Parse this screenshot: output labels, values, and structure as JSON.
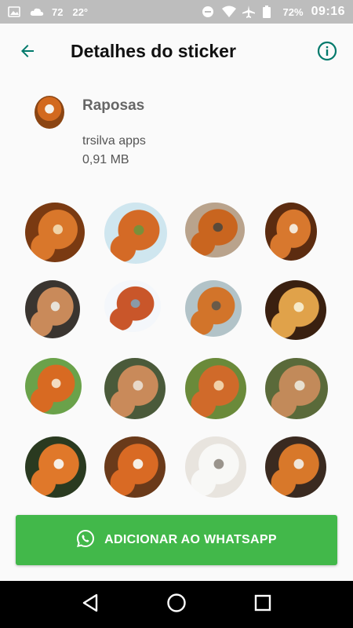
{
  "status_bar": {
    "left_icons": [
      "image-icon",
      "cloud-icon"
    ],
    "battery_small": "72",
    "temperature": "22°",
    "right_icons": [
      "do-not-disturb-icon",
      "wifi-icon",
      "airplane-icon",
      "battery-icon"
    ],
    "battery_percent": "72%",
    "time": "09:16"
  },
  "app_bar": {
    "back_icon": "arrow-left-icon",
    "title": "Detalhes do sticker",
    "info_icon": "info-icon",
    "accent": "#00796b"
  },
  "pack": {
    "name": "Raposas",
    "publisher": "trsilva apps",
    "size": "0,91 MB"
  },
  "stickers": [
    {
      "name": "fox-sticker-1",
      "colors": [
        "#7a3a12",
        "#d9772b",
        "#f0d3a8"
      ]
    },
    {
      "name": "fox-sticker-2",
      "colors": [
        "#cfe6ef",
        "#d46a26",
        "#7a8f3a"
      ]
    },
    {
      "name": "fox-sticker-3",
      "colors": [
        "#b9a38c",
        "#c9651f",
        "#5a4a3a"
      ]
    },
    {
      "name": "fox-sticker-4",
      "colors": [
        "#5c2c10",
        "#d8782e",
        "#f4e7d7"
      ]
    },
    {
      "name": "fox-sticker-5",
      "colors": [
        "#3a3530",
        "#c98a5a",
        "#e8e2d8"
      ]
    },
    {
      "name": "fox-sticker-6",
      "colors": [
        "#f4f7fb",
        "#c9562a",
        "#8a9aa8"
      ]
    },
    {
      "name": "fox-sticker-7",
      "colors": [
        "#b2c3c8",
        "#d2742a",
        "#6a5a48"
      ]
    },
    {
      "name": "fox-sticker-8",
      "colors": [
        "#3a2010",
        "#e0a24a",
        "#f6e9c8"
      ]
    },
    {
      "name": "fox-sticker-9",
      "colors": [
        "#6aa24a",
        "#d86a22",
        "#f2dcc2"
      ]
    },
    {
      "name": "fox-sticker-10",
      "colors": [
        "#4a5a3a",
        "#c98a5a",
        "#e8d8c8"
      ]
    },
    {
      "name": "fox-sticker-11",
      "colors": [
        "#6a8a3a",
        "#d06a2a",
        "#f0d0a8"
      ]
    },
    {
      "name": "fox-sticker-12",
      "colors": [
        "#5a6a3a",
        "#c28a5a",
        "#e8e0d0"
      ]
    },
    {
      "name": "fox-sticker-13",
      "colors": [
        "#2a3a20",
        "#e0782a",
        "#f6efe6"
      ]
    },
    {
      "name": "fox-sticker-14",
      "colors": [
        "#6a3a1a",
        "#d96a24",
        "#f6efe6"
      ]
    },
    {
      "name": "fox-sticker-15",
      "colors": [
        "#e8e4de",
        "#f8f8f6",
        "#9a948c"
      ]
    },
    {
      "name": "fox-sticker-16",
      "colors": [
        "#3a2a20",
        "#d8782a",
        "#f0e6da"
      ]
    }
  ],
  "add_button": {
    "icon": "whatsapp-icon",
    "label": "ADICIONAR AO WHATSAPP",
    "color": "#42b84a"
  },
  "nav_bar": {
    "back_icon": "nav-back-triangle-icon",
    "home_icon": "nav-home-circle-icon",
    "recents_icon": "nav-recents-square-icon"
  }
}
